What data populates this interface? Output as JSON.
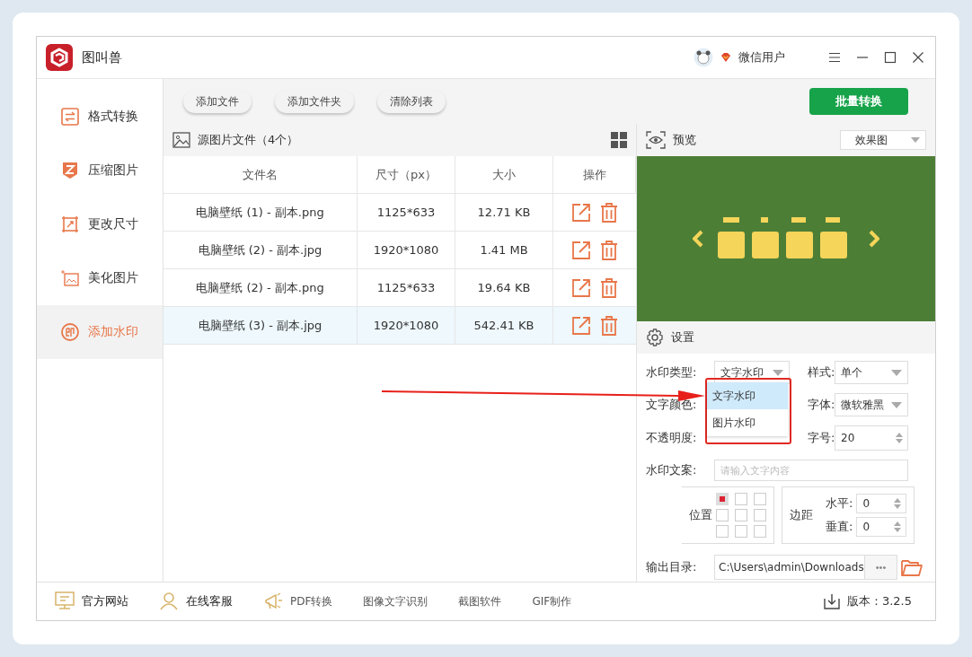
{
  "app": {
    "title": "图叫兽",
    "user": "微信用户"
  },
  "sidebar": {
    "items": [
      {
        "label": "格式转换",
        "kind": "convert",
        "selected": false
      },
      {
        "label": "压缩图片",
        "kind": "compress",
        "selected": false
      },
      {
        "label": "更改尺寸",
        "kind": "resize",
        "selected": false
      },
      {
        "label": "美化图片",
        "kind": "beautify",
        "selected": false
      },
      {
        "label": "添加水印",
        "kind": "watermark",
        "selected": true
      }
    ]
  },
  "toolbar": {
    "buttons": [
      "添加文件",
      "添加文件夹",
      "清除列表"
    ],
    "primary": "批量转换"
  },
  "file_list": {
    "title": "源图片文件（4个）",
    "columns": [
      "文件名",
      "尺寸（px）",
      "大小",
      "操作"
    ],
    "rows": [
      {
        "cells": [
          "电脑壁纸 (1) - 副本.png",
          "1125*633",
          "12.71 KB"
        ],
        "selected": false
      },
      {
        "cells": [
          "电脑壁纸 (2) - 副本.jpg",
          "1920*1080",
          "1.41 MB"
        ],
        "selected": false
      },
      {
        "cells": [
          "电脑壁纸 (2) - 副本.png",
          "1125*633",
          "19.64 KB"
        ],
        "selected": false
      },
      {
        "cells": [
          "电脑壁纸 (3) - 副本.jpg",
          "1920*1080",
          "542.41 KB"
        ],
        "selected": true
      }
    ]
  },
  "preview": {
    "title": "预览",
    "mode": "效果图"
  },
  "settings": {
    "title": "设置",
    "type": {
      "label": "水印类型:",
      "value": "文字水印",
      "expanded": true,
      "options": [
        {
          "label": "文字水印",
          "selected": true
        },
        {
          "label": "图片水印",
          "selected": false
        }
      ]
    },
    "style": {
      "label": "样式:",
      "value": "单个"
    },
    "color": {
      "label": "文字颜色:"
    },
    "font": {
      "label": "字体:",
      "value": "微软雅黑"
    },
    "opacity": {
      "label": "不透明度:"
    },
    "size": {
      "label": "字号:",
      "value": "20"
    },
    "text": {
      "label": "水印文案:",
      "placeholder": "请输入文字内容"
    },
    "position": {
      "label": "位置",
      "cells": [
        {
          "selected": true
        },
        {
          "selected": false
        },
        {
          "selected": false
        },
        {
          "selected": false
        },
        {
          "selected": false
        },
        {
          "selected": false
        },
        {
          "selected": false
        },
        {
          "selected": false
        },
        {
          "selected": false
        }
      ]
    },
    "margin": {
      "label": "边距",
      "horizontal_label": "水平:",
      "horizontal": "0",
      "vertical_label": "垂直:",
      "vertical": "0"
    },
    "output": {
      "label": "输出目录:",
      "value": "C:\\Users\\admin\\Downloads",
      "browse": "•••"
    }
  },
  "footer": {
    "links": [
      {
        "label": "官方网站",
        "kind": "monitor"
      },
      {
        "label": "在线客服",
        "kind": "person"
      },
      {
        "label": "PDF转换",
        "kind": "pdf"
      },
      {
        "label": "图像文字识别",
        "kind": "none"
      },
      {
        "label": "截图软件",
        "kind": "none"
      },
      {
        "label": "GIF制作",
        "kind": "none"
      }
    ],
    "version": "版本：3.2.5"
  }
}
